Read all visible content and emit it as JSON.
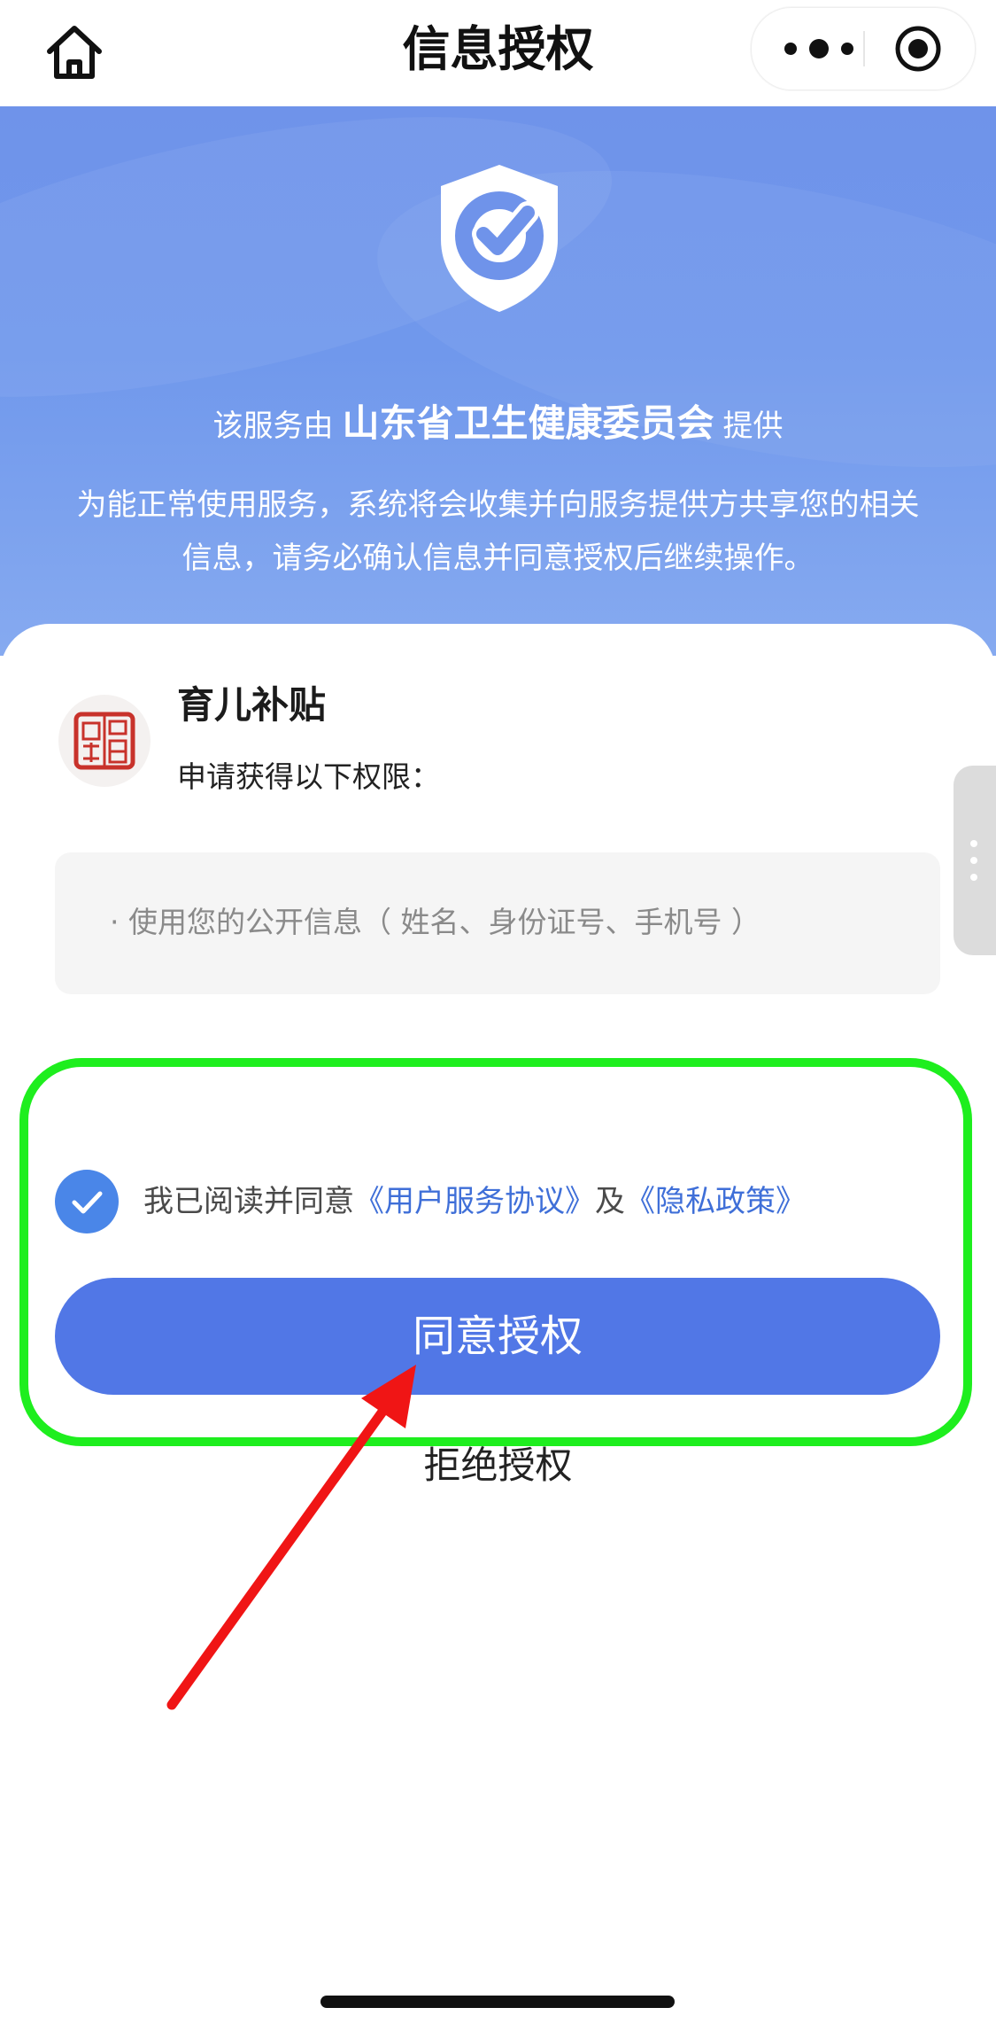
{
  "navbar": {
    "title": "信息授权",
    "home_icon": "home-icon",
    "more_icon": "more-dots-icon",
    "close_icon": "target-close-icon"
  },
  "hero": {
    "provider_prefix": "该服务由",
    "provider_name": "山东省卫生健康委员会",
    "provider_suffix": "提供",
    "notice": "为能正常使用服务，系统将会收集并向服务提供方共享您的相关信息，请务必确认信息并同意授权后继续操作。",
    "shield_icon": "shield-check-icon"
  },
  "app": {
    "name": "育儿补贴",
    "request_text": "申请获得以下权限：",
    "logo_icon": "red-seal-logo"
  },
  "permissions": [
    "· 使用您的公开信息（ 姓名、身份证号、手机号 ）"
  ],
  "agreement": {
    "checked": true,
    "prefix": "我已阅读并同意",
    "user_agreement": "《用户服务协议》",
    "and": "及",
    "privacy_policy": "《隐私政策》"
  },
  "buttons": {
    "agree": "同意授权",
    "reject": "拒绝授权"
  },
  "colors": {
    "primary": "#5177E6",
    "hero_blue": "#7098EC",
    "link": "#3F6FD8",
    "highlight": "#1EEE1E",
    "arrow": "#F01515"
  }
}
